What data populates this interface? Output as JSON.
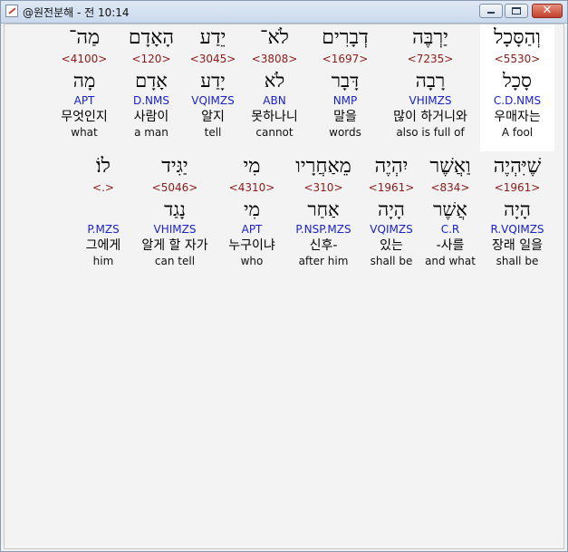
{
  "window": {
    "title": "@원전분해 - 전 10:14",
    "close_glyph": "✕"
  },
  "row1": [
    {
      "heb": "וְהַסָּכָל",
      "strong": "<5530>",
      "lemma": "סָכָל",
      "morph": "C.D.NMS",
      "ko": "우매자는",
      "en": "A fool"
    },
    {
      "heb": "יַרְבֶּה",
      "strong": "<7235>",
      "lemma": "רָבָה",
      "morph": "VHIMZS",
      "ko": "많이 하거니와",
      "en": "also is full of"
    },
    {
      "heb": "דְבָרִים",
      "strong": "<1697>",
      "lemma": "דָּבָר",
      "morph": "NMP",
      "ko": "말을",
      "en": "words"
    },
    {
      "heb": "לֹא־",
      "strong": "<3808>",
      "lemma": "לֹא",
      "morph": "ABN",
      "ko": "못하나니",
      "en": "cannot"
    },
    {
      "heb": "יֵדַע",
      "strong": "<3045>",
      "lemma": "יָדַע",
      "morph": "VQIMZS",
      "ko": "알지",
      "en": "tell"
    },
    {
      "heb": "הָאָדָם",
      "strong": "<120>",
      "lemma": "אָדָם",
      "morph": "D.NMS",
      "ko": "사람이",
      "en": "a man"
    },
    {
      "heb": "מַה־",
      "strong": "<4100>",
      "lemma": "מָה",
      "morph": "APT",
      "ko": "무엇인지",
      "en": "what"
    }
  ],
  "row2": [
    {
      "heb": "שֶׁיִּהְיֶה",
      "strong": "<1961>",
      "lemma": "הָיָה",
      "morph": "R.VQIMZS",
      "ko": "장래 일을",
      "en": "shall be"
    },
    {
      "heb": "וַאֲשֶׁר",
      "strong": "<834>",
      "lemma": "אֲשֶׁר",
      "morph": "C.R",
      "ko": "-사를",
      "en": "and what"
    },
    {
      "heb": "יִהְיֶה",
      "strong": "<1961>",
      "lemma": "הָיָה",
      "morph": "VQIMZS",
      "ko": "있는",
      "en": "shall be"
    },
    {
      "heb": "מֵאַחֲרָיו",
      "strong": "<310>",
      "lemma": "אַחַר",
      "morph": "P.NSP.MZS",
      "ko": "신후-",
      "en": "after him"
    },
    {
      "heb": "מִי",
      "strong": "<4310>",
      "lemma": "מִי",
      "morph": "APT",
      "ko": "누구이냐",
      "en": "who"
    },
    {
      "heb": "יַגִּיד",
      "strong": "<5046>",
      "lemma": "נָגַד",
      "morph": "VHIMZS",
      "ko": "알게 할 자가",
      "en": "can tell"
    },
    {
      "heb": "לוֹ׃",
      "strong": "<.>",
      "lemma": "",
      "morph": "P.MZS",
      "ko": "그에게",
      "en": "him"
    }
  ]
}
